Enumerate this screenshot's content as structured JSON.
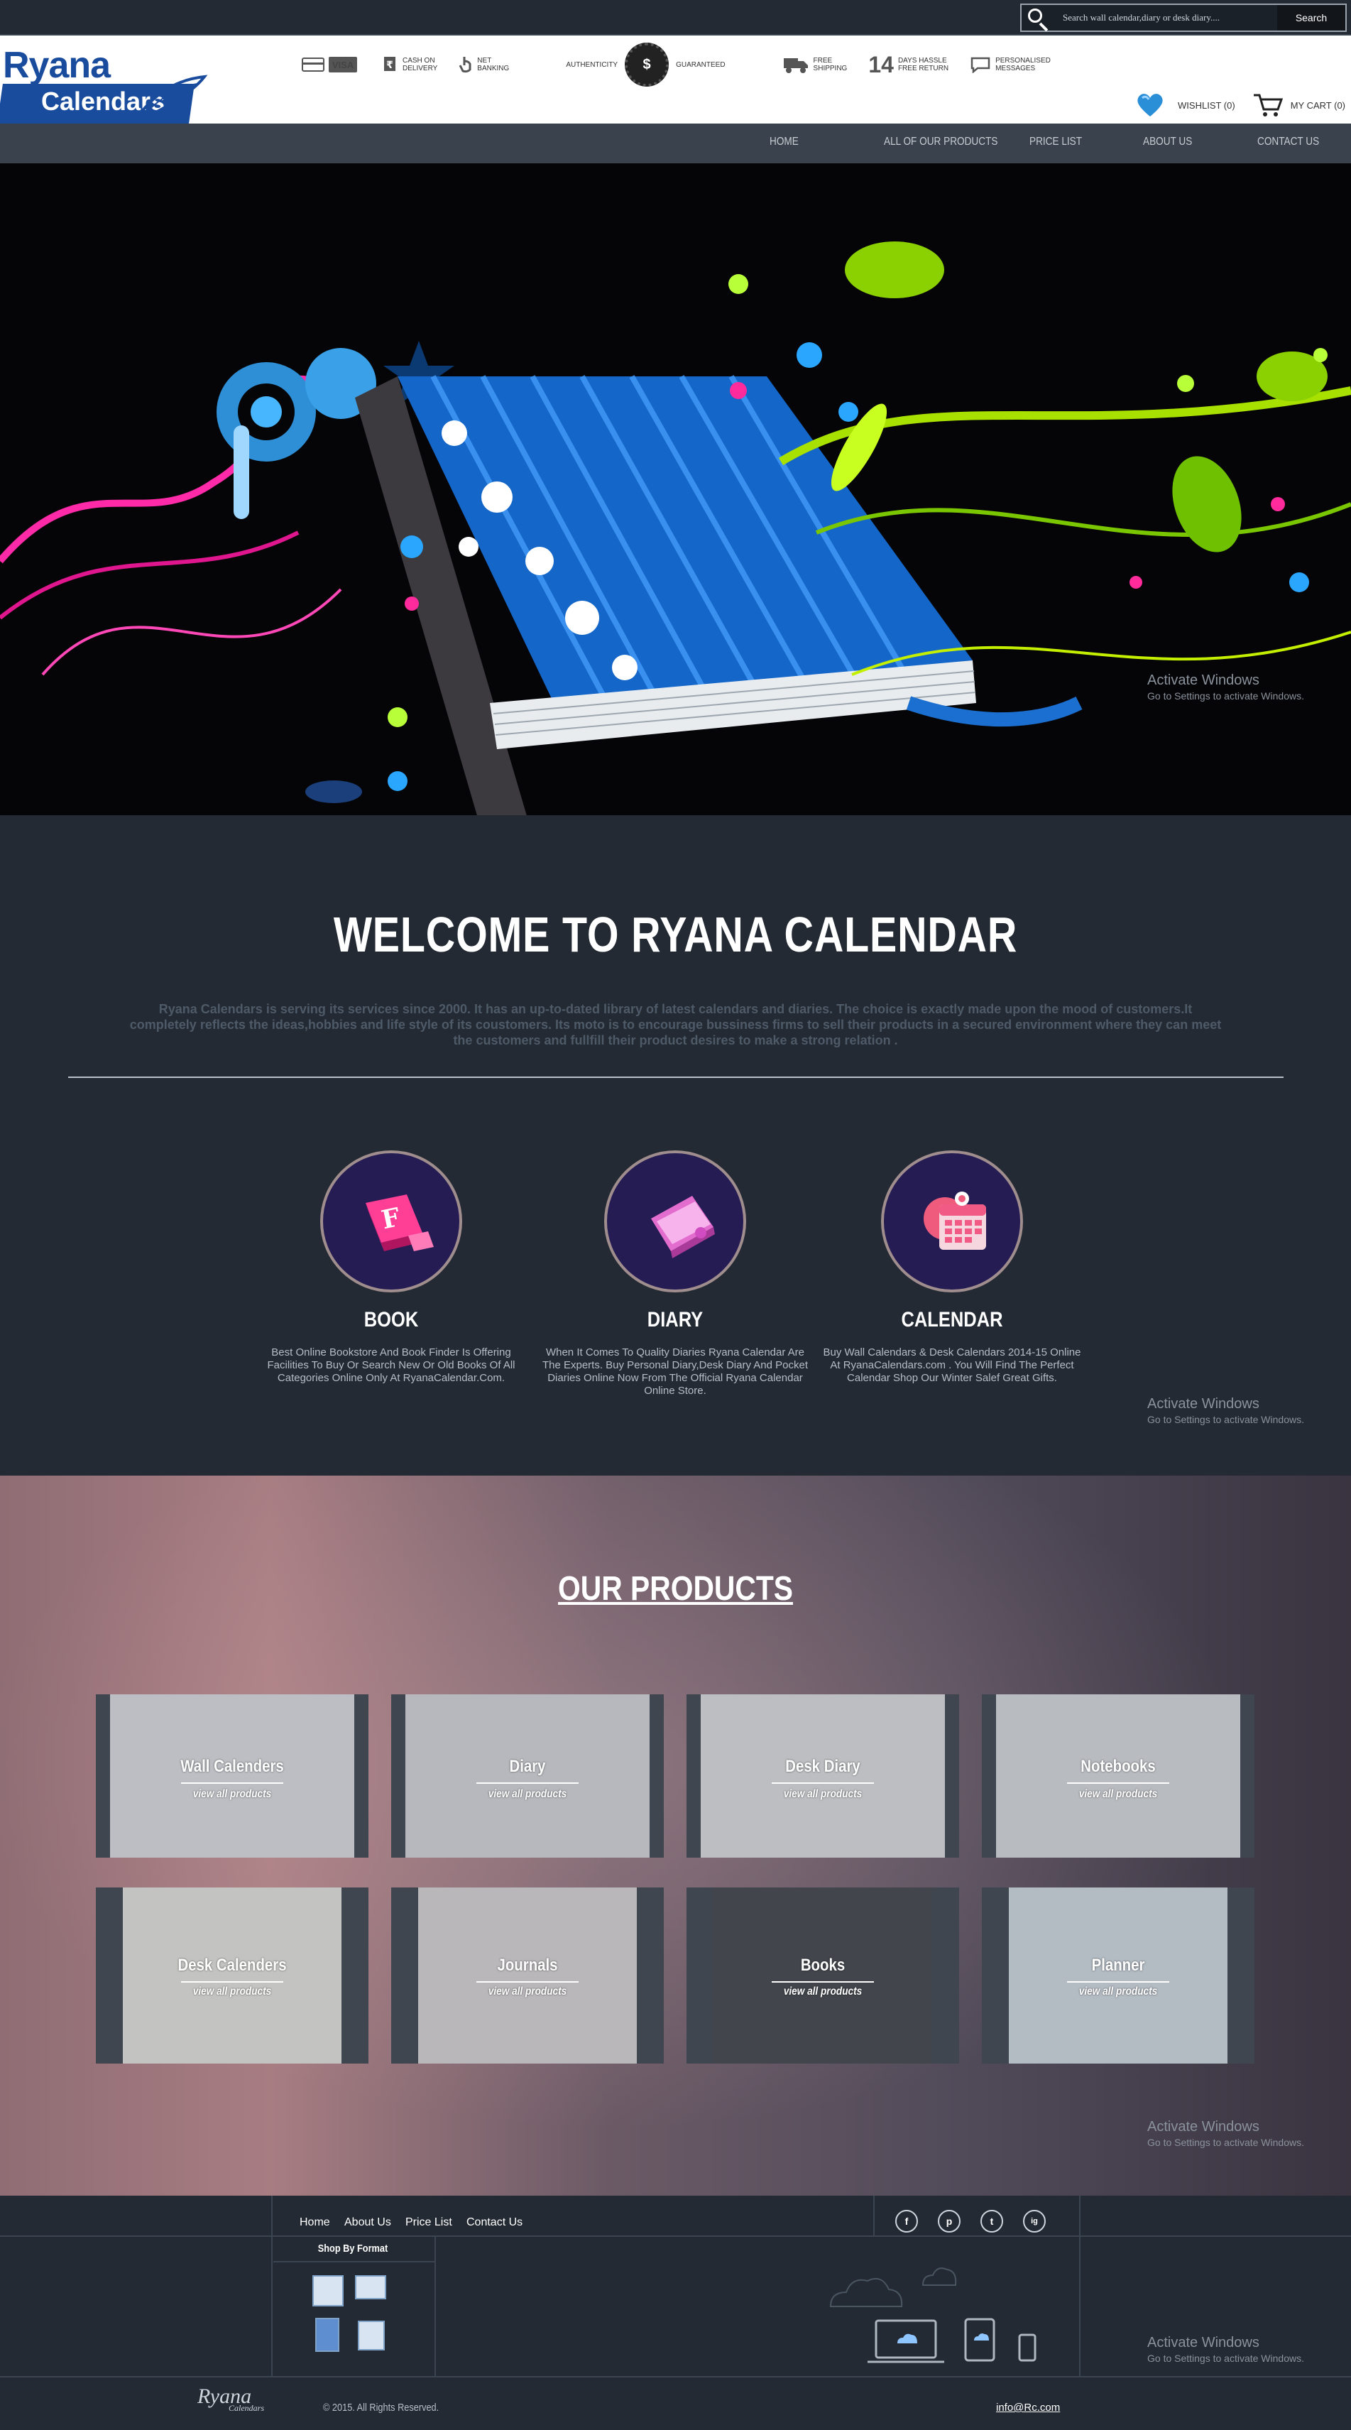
{
  "search": {
    "placeholder": "Search wall calendar,diary or desk diary....",
    "button": "Search"
  },
  "features": {
    "card_icon": "credit-card-icon",
    "visa": "VISA",
    "cod": "CASH ON\nDELIVERY",
    "net": "NET\nBANKING",
    "auth_left": "AUTHENTICITY",
    "auth_right": "GUARANTEED",
    "seal_symbol": "$",
    "free_ship": "FREE\nSHIPPING",
    "return_days": "14",
    "returns": "DAYS HASSLE\nFREE RETURN",
    "messages": "PERSONALISED\nMESSAGES"
  },
  "logo": {
    "title": "Ryana",
    "subtitle": "Calendars"
  },
  "user": {
    "wishlist": "WISHLIST (0)",
    "cart": "MY CART (0)"
  },
  "nav": [
    "HOME",
    "ALL OF OUR PRODUCTS",
    "PRICE LIST",
    "ABOUT US",
    "CONTACT US"
  ],
  "windows": {
    "line1": "Activate Windows",
    "line2": "Go to Settings to activate Windows."
  },
  "welcome": {
    "title": "WELCOME TO RYANA CALENDAR",
    "text": "Ryana Calendars is serving its services since 2000. It has an up-to-dated library of latest calendars and diaries. The choice is exactly made upon the mood of customers.It completely reflects the ideas,hobbies and life style of its coustomers. Its moto is to encourage bussiness firms to sell their products in a secured environment where they can meet the customers and fullfill their product desires to make a strong relation ."
  },
  "featured": [
    {
      "title": "BOOK",
      "desc": "Best Online Bookstore And Book Finder Is Offering Facilities To Buy Or Search New Or Old Books Of All Categories Online Only At RyanaCalendar.Com."
    },
    {
      "title": "DIARY",
      "desc": "When It Comes To Quality Diaries Ryana Calendar Are The Experts. Buy Personal Diary,Desk Diary And Pocket Diaries Online Now From The Official Ryana Calendar Online Store."
    },
    {
      "title": "CALENDAR",
      "desc": "Buy Wall Calendars & Desk Calendars 2014-15 Online At RyanaCalendars.com . You Will Find The Perfect Calendar Shop Our Winter Salef Great Gifts."
    }
  ],
  "products": {
    "title": "OUR PRODUCTS",
    "link": "view all products",
    "items": [
      {
        "name": "Wall Calenders",
        "tone": "#cfd1d4"
      },
      {
        "name": "Diary",
        "tone": "#c8c9cc"
      },
      {
        "name": "Desk Diary",
        "tone": "#cfd0d2"
      },
      {
        "name": "Notebooks",
        "tone": "#cacdd1"
      },
      {
        "name": "Desk Calenders",
        "tone": "#d8d8d2"
      },
      {
        "name": "Journals",
        "tone": "#cbc7c7"
      },
      {
        "name": "Books",
        "tone": "#2c3036"
      },
      {
        "name": "Planner",
        "tone": "#c3ccd4"
      }
    ]
  },
  "footer": {
    "links": [
      "Home",
      "About Us",
      "Price List",
      "Contact Us"
    ],
    "social": [
      "f",
      "p",
      "t",
      "ig"
    ],
    "shop_by_format": "Shop By Format",
    "copyright": "© 2015. All Rights Reserved.",
    "email": "info@Rc.com",
    "logo_title": "Ryana",
    "logo_sub": "Calendars"
  }
}
